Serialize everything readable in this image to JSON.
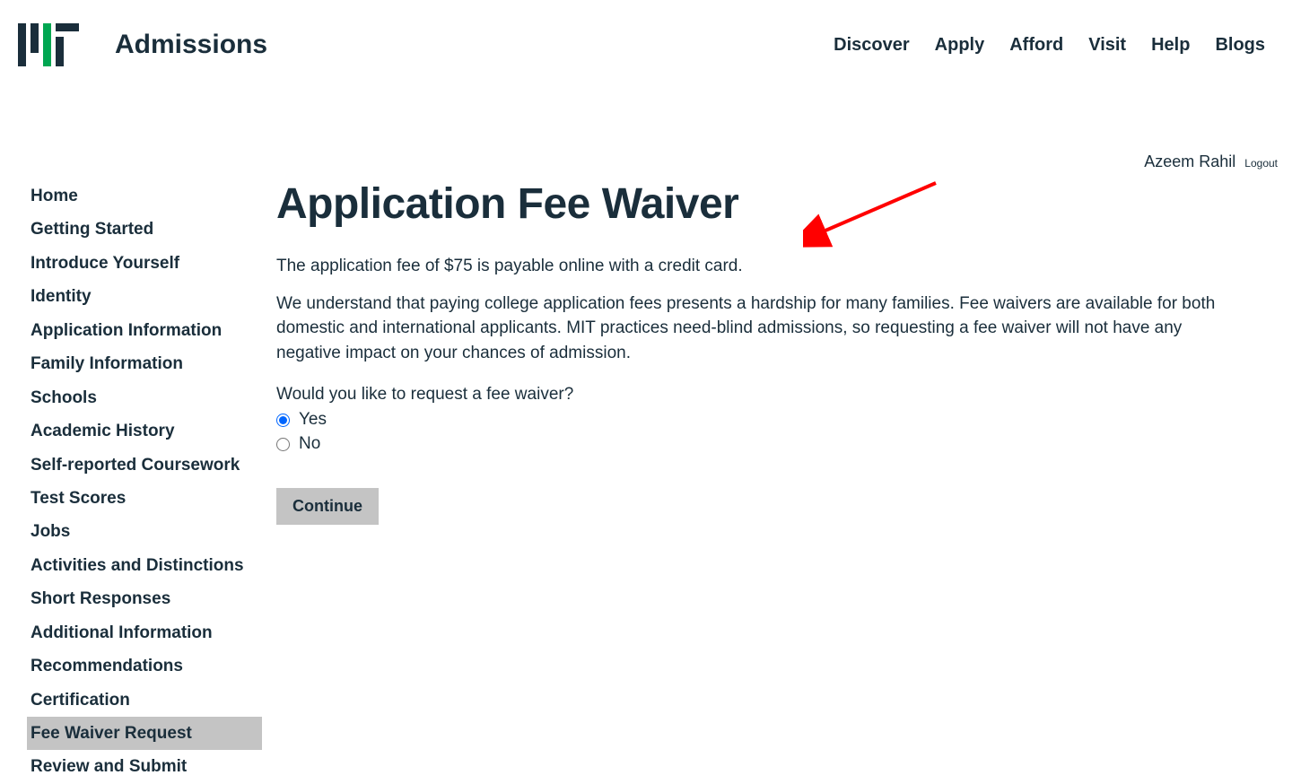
{
  "header": {
    "site_title": "Admissions",
    "nav": [
      "Discover",
      "Apply",
      "Afford",
      "Visit",
      "Help",
      "Blogs"
    ]
  },
  "user": {
    "name": "Azeem Rahil",
    "logout_label": "Logout"
  },
  "sidebar": {
    "items": [
      {
        "label": "Home",
        "active": false
      },
      {
        "label": "Getting Started",
        "active": false
      },
      {
        "label": "Introduce Yourself",
        "active": false
      },
      {
        "label": "Identity",
        "active": false
      },
      {
        "label": "Application Information",
        "active": false
      },
      {
        "label": "Family Information",
        "active": false
      },
      {
        "label": "Schools",
        "active": false
      },
      {
        "label": "Academic History",
        "active": false
      },
      {
        "label": "Self-reported Coursework",
        "active": false
      },
      {
        "label": "Test Scores",
        "active": false
      },
      {
        "label": "Jobs",
        "active": false
      },
      {
        "label": "Activities and Distinctions",
        "active": false
      },
      {
        "label": "Short Responses",
        "active": false
      },
      {
        "label": "Additional Information",
        "active": false
      },
      {
        "label": "Recommendations",
        "active": false
      },
      {
        "label": "Certification",
        "active": false
      },
      {
        "label": "Fee Waiver Request",
        "active": true
      },
      {
        "label": "Review and Submit",
        "active": false
      }
    ]
  },
  "main": {
    "title": "Application Fee Waiver",
    "para1": "The application fee of $75 is payable online with a credit card.",
    "para2": "We understand that paying college application fees presents a hardship for many families. Fee waivers are available for both domestic and international applicants. MIT practices need-blind admissions, so requesting a fee waiver will not have any negative impact on your chances of admission.",
    "question": "Would you like to request a fee waiver?",
    "options": {
      "yes": "Yes",
      "no": "No"
    },
    "selected": "yes",
    "continue_label": "Continue"
  },
  "colors": {
    "text": "#1a2e3b",
    "active_bg": "#c4c4c4",
    "accent_green": "#00a651",
    "annotation_red": "#ff0000"
  }
}
